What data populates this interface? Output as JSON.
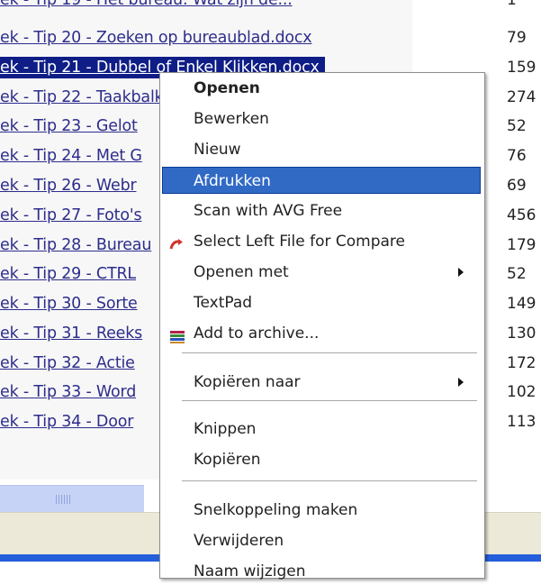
{
  "files": [
    {
      "name": "ek - Tip 19 - Het bureau: Wat zijn de...",
      "size": "1"
    },
    {
      "name": "ek - Tip 20 - Zoeken op bureaublad.docx",
      "size": "79"
    },
    {
      "name": "ek - Tip 21 - Dubbel of Enkel Klikken.docx",
      "size": "159",
      "selected": true
    },
    {
      "name": "ek - Tip 22 - Taakbalk",
      "size": "274"
    },
    {
      "name": "ek - Tip 23 - Gelot",
      "size": "52"
    },
    {
      "name": "ek - Tip 24 - Met G",
      "size": "76"
    },
    {
      "name": "ek - Tip 26 - Webr",
      "size": "69"
    },
    {
      "name": "ek - Tip 27 - Foto's",
      "size": "456"
    },
    {
      "name": "ek - Tip 28 - Bureau",
      "size": "179"
    },
    {
      "name": "ek - Tip 29 - CTRL",
      "size": "52"
    },
    {
      "name": "ek - Tip 30 - Sorte",
      "size": "149"
    },
    {
      "name": "ek - Tip 31 - Reeks",
      "size": "130"
    },
    {
      "name": "ek - Tip 32 - Actie",
      "size": "172"
    },
    {
      "name": "ek - Tip 33 - Word",
      "size": "102"
    },
    {
      "name": "ek - Tip 34 - Door",
      "size": "113"
    }
  ],
  "context_menu": {
    "items": [
      {
        "label": "Openen",
        "bold": true
      },
      {
        "label": "Bewerken"
      },
      {
        "label": "Nieuw"
      },
      {
        "label": "Afdrukken",
        "highlighted": true
      },
      {
        "label": "Scan with AVG Free"
      },
      {
        "label": "Select Left File for Compare",
        "icon": "compare-icon"
      },
      {
        "label": "Openen met",
        "submenu": true
      },
      {
        "label": "TextPad"
      },
      {
        "label": "Add to archive...",
        "icon": "archive-icon"
      },
      {
        "separator": true
      },
      {
        "label": "Kopiëren naar",
        "submenu": true
      },
      {
        "separator": true
      },
      {
        "label": "Knippen"
      },
      {
        "label": "Kopiëren"
      },
      {
        "separator": true
      },
      {
        "label": "Snelkoppeling maken"
      },
      {
        "label": "Verwijderen"
      },
      {
        "label": "Naam wijzigen"
      }
    ]
  },
  "colors": {
    "selection": "#0f1d86",
    "menu_highlight": "#316ac5",
    "link_text": "#2d2d8c"
  }
}
